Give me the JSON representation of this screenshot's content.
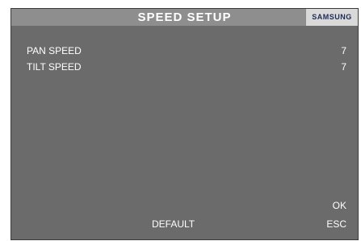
{
  "header": {
    "title": "SPEED SETUP",
    "brand": "SAMSUNG"
  },
  "settings": [
    {
      "label": "PAN SPEED",
      "value": "7"
    },
    {
      "label": "TILT SPEED",
      "value": "7"
    }
  ],
  "actions": {
    "ok_label": "OK",
    "default_label": "DEFAULT",
    "esc_label": "ESC"
  },
  "colors": {
    "background": "#6b6b6b",
    "title_bar": "#8e8e8e",
    "brand_box": "#d9d9d9",
    "brand_text": "#1e2a55",
    "text": "#ffffff"
  }
}
